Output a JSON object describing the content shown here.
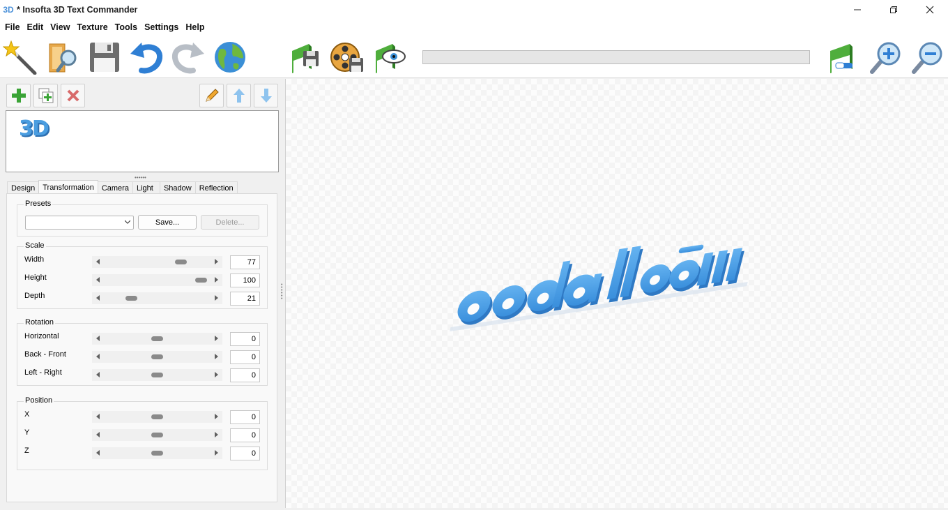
{
  "window": {
    "app_icon": "3D",
    "title": "* Insofta 3D Text Commander"
  },
  "menu": [
    "File",
    "Edit",
    "View",
    "Texture",
    "Tools",
    "Settings",
    "Help"
  ],
  "toolbar": {
    "progress_percent": 0
  },
  "text_list": {
    "items": [
      "3D"
    ]
  },
  "tabs": [
    "Design",
    "Transformation",
    "Camera",
    "Light",
    "Shadow",
    "Reflection"
  ],
  "active_tab": "Transformation",
  "presets": {
    "title": "Presets",
    "selected": "",
    "save_label": "Save...",
    "delete_label": "Delete..."
  },
  "scale": {
    "title": "Scale",
    "rows": [
      {
        "label": "Width",
        "value": "77",
        "level": 0.77
      },
      {
        "label": "Height",
        "value": "100",
        "level": 1.0
      },
      {
        "label": "Depth",
        "value": "21",
        "level": 0.21
      }
    ]
  },
  "rotation": {
    "title": "Rotation",
    "rows": [
      {
        "label": "Horizontal",
        "value": "0",
        "level": 0.5
      },
      {
        "label": "Back - Front",
        "value": "0",
        "level": 0.5
      },
      {
        "label": "Left - Right",
        "value": "0",
        "level": 0.5
      }
    ]
  },
  "position": {
    "title": "Position",
    "rows": [
      {
        "label": "X",
        "value": "0",
        "level": 0.5
      },
      {
        "label": "Y",
        "value": "0",
        "level": 0.5
      },
      {
        "label": "Z",
        "value": "0",
        "level": 0.5
      }
    ]
  },
  "colors": {
    "text_3d": "#4a9de0",
    "text_3d_side": "#2f79c4"
  }
}
